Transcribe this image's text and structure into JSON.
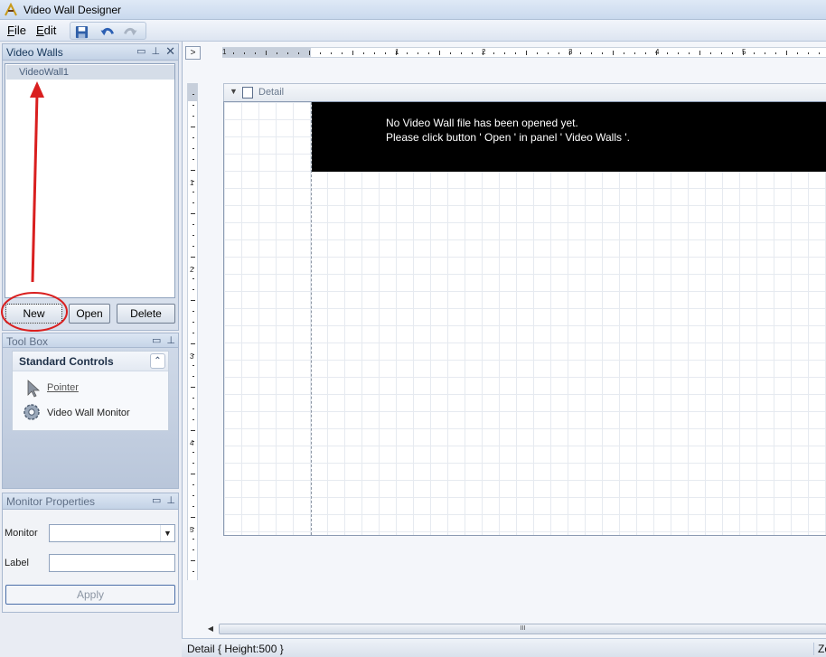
{
  "window": {
    "title": "Video Wall Designer"
  },
  "menu": {
    "file_label": "File",
    "file_key": "F",
    "file_rest": "ile",
    "edit_label": "Edit",
    "edit_key": "E",
    "edit_rest": "dit"
  },
  "toolbar": {
    "icons": [
      "save-icon",
      "undo-icon",
      "redo-icon"
    ]
  },
  "video_walls_panel": {
    "title": "Video Walls",
    "items": [
      "VideoWall1"
    ],
    "new_label": "New",
    "open_label": "Open",
    "delete_label": "Delete"
  },
  "toolbox_panel": {
    "title": "Tool Box",
    "group_title": "Standard Controls",
    "tools": [
      {
        "label": "Pointer",
        "icon": "pointer-icon"
      },
      {
        "label": "Video Wall Monitor",
        "icon": "monitor-gear-icon"
      }
    ]
  },
  "monitor_properties_panel": {
    "title": "Monitor Properties",
    "monitor_label": "Monitor",
    "monitor_value": "",
    "label_label": "Label",
    "label_value": "",
    "apply_label": "Apply"
  },
  "designer": {
    "corner_label": ">",
    "h_ruler_numbers": [
      "1",
      "1",
      "2",
      "3",
      "4",
      "5"
    ],
    "v_ruler_numbers": [
      "1",
      "2",
      "3",
      "4",
      "5"
    ],
    "band_title": "Detail",
    "message_line1": "No Video Wall file has been opened yet.",
    "message_line2": "Please click button ' Open ' in panel ' Video Walls '.",
    "scroll_grip": "III"
  },
  "status": {
    "text": "Detail { Height:500 }",
    "right_text": "Zo"
  },
  "colors": {
    "annotation_red": "#d91f1f",
    "accent": "#15365a"
  }
}
